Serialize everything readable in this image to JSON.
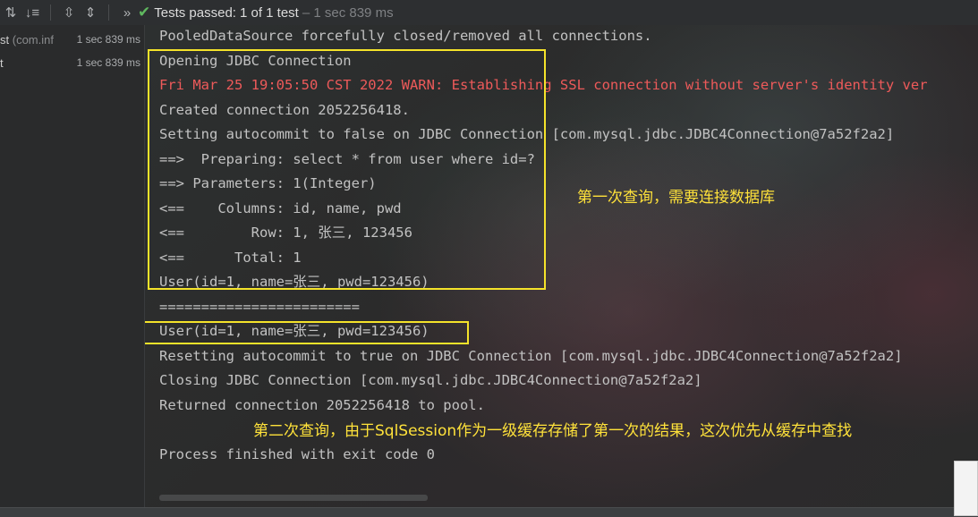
{
  "toolbar": {
    "icons": [
      "sort-icon",
      "sort-duration-icon",
      "expand-all-icon",
      "collapse-all-icon",
      "more-icon"
    ],
    "status": {
      "title": "Tests passed:",
      "count": "1 of 1 test",
      "time": "– 1 sec 839 ms"
    }
  },
  "tree": {
    "items": [
      {
        "name": "st",
        "pkg": " (com.inf",
        "time": "1 sec 839 ms"
      },
      {
        "name": "t",
        "pkg": "",
        "time": "1 sec 839 ms"
      }
    ]
  },
  "console": {
    "lines": [
      "PooledDataSource forcefully closed/removed all connections.",
      "Opening JDBC Connection",
      "Fri Mar 25 19:05:50 CST 2022 WARN: Establishing SSL connection without server's identity ver",
      "Created connection 2052256418.",
      "Setting autocommit to false on JDBC Connection [com.mysql.jdbc.JDBC4Connection@7a52f2a2]",
      "==>  Preparing: select * from user where id=?",
      "==> Parameters: 1(Integer)",
      "<==    Columns: id, name, pwd",
      "<==        Row: 1, 张三, 123456",
      "<==      Total: 1",
      "User(id=1, name=张三, pwd=123456)",
      "========================",
      "User(id=1, name=张三, pwd=123456)",
      "Resetting autocommit to true on JDBC Connection [com.mysql.jdbc.JDBC4Connection@7a52f2a2]",
      "Closing JDBC Connection [com.mysql.jdbc.JDBC4Connection@7a52f2a2]",
      "Returned connection 2052256418 to pool.",
      "Process finished with exit code 0"
    ]
  },
  "annotations": {
    "first": "第一次查询，需要连接数据库",
    "second": "第二次查询，由于SqlSession作为一级缓存存储了第一次的结果，这次优先从缓存中查找"
  },
  "colors": {
    "highlight": "#f5e32a",
    "warn": "#ee5a5a",
    "passed": "#5fb85f"
  }
}
